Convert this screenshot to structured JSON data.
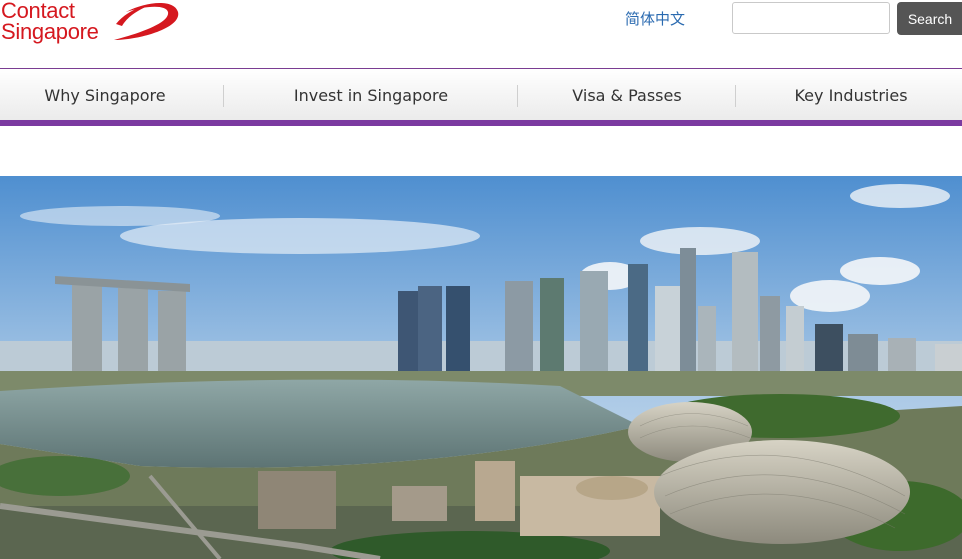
{
  "header": {
    "logo_line1": "Contact",
    "logo_line2": "Singapore",
    "lang_link": "简体中文",
    "search_placeholder": "",
    "search_button": "Search"
  },
  "nav": {
    "items": [
      {
        "label": "Why Singapore"
      },
      {
        "label": "Invest in Singapore"
      },
      {
        "label": "Visa & Passes"
      },
      {
        "label": "Key Industries"
      }
    ]
  },
  "colors": {
    "brand_red": "#d5181f",
    "nav_purple": "#7b3aa0",
    "link_blue": "#2a6ab0",
    "search_button": "#555555"
  }
}
